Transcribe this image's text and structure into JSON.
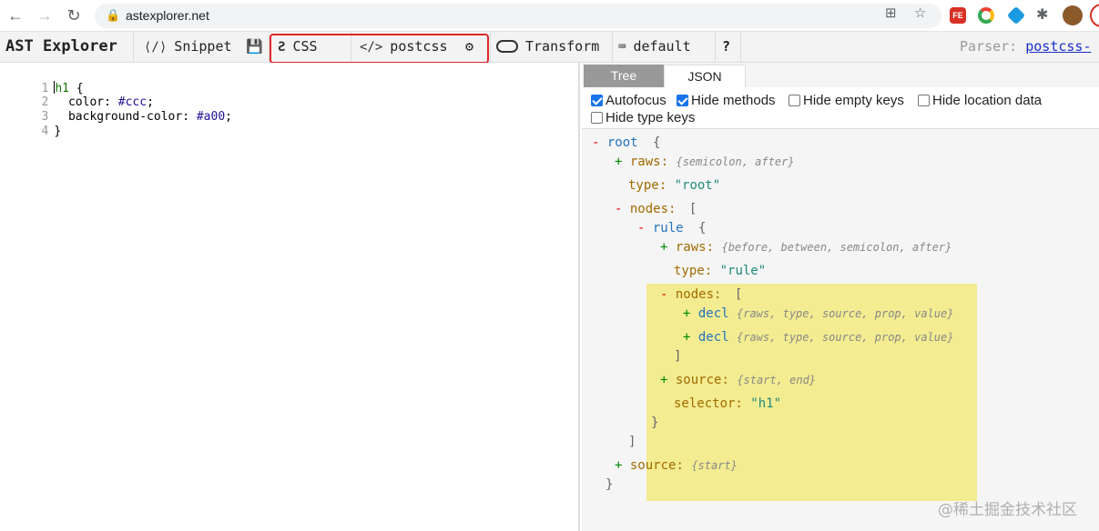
{
  "browser": {
    "url": "astexplorer.net",
    "back_icon": "arrow-left",
    "forward_icon": "arrow-right",
    "reload_icon": "reload",
    "ext_fe_label": "FE"
  },
  "toolbar": {
    "title": "AST Explorer",
    "snippet": "Snippet",
    "language": "CSS",
    "parser_name": "postcss",
    "transform": "Transform",
    "keymap": "default",
    "help": "?",
    "parser_label": "Parser:",
    "parser_link": "postcss-"
  },
  "editor": {
    "lines": [
      {
        "num": "1",
        "selector": "h1",
        "rest": " {"
      },
      {
        "num": "2",
        "prop": "  color: ",
        "value": "#ccc",
        "end": ";"
      },
      {
        "num": "3",
        "prop": "  background-color: ",
        "value": "#a00",
        "end": ";"
      },
      {
        "num": "4",
        "rest": "}"
      }
    ]
  },
  "output": {
    "tabs": [
      "Tree",
      "JSON"
    ],
    "active_tab": "Tree",
    "options": [
      {
        "label": "Autofocus",
        "checked": true
      },
      {
        "label": "Hide methods",
        "checked": true
      },
      {
        "label": "Hide empty keys",
        "checked": false
      },
      {
        "label": "Hide location data",
        "checked": false
      },
      {
        "label": "Hide type keys",
        "checked": false
      }
    ],
    "tree": {
      "root_toggle": "-",
      "root_name": "root",
      "root_open": "{",
      "raws_toggle": "+",
      "raws_key": "raws:",
      "raws_summary": "{semicolon, after}",
      "type_key": "type:",
      "type_value": "\"root\"",
      "nodes_toggle": "-",
      "nodes_key": "nodes:",
      "nodes_open": "[",
      "rule_toggle": "-",
      "rule_name": "rule",
      "rule_open": "{",
      "rule_raws_toggle": "+",
      "rule_raws_key": "raws:",
      "rule_raws_summary": "{before, between, semicolon, after}",
      "rule_type_key": "type:",
      "rule_type_value": "\"rule\"",
      "rule_nodes_toggle": "-",
      "rule_nodes_key": "nodes:",
      "rule_nodes_open": "[",
      "decl1_toggle": "+",
      "decl1_name": "decl",
      "decl1_summary": "{raws, type, source, prop, value}",
      "decl2_toggle": "+",
      "decl2_name": "decl",
      "decl2_summary": "{raws, type, source, prop, value}",
      "rule_nodes_close": "]",
      "rule_source_toggle": "+",
      "rule_source_key": "source:",
      "rule_source_summary": "{start, end}",
      "selector_key": "selector:",
      "selector_value": "\"h1\"",
      "rule_close": "}",
      "nodes_close": "]",
      "source_toggle": "+",
      "source_key": "source:",
      "source_summary": "{start}",
      "root_close": "}"
    }
  },
  "watermark": "@稀土掘金技术社区",
  "colors": {
    "highlight_box": "#e0272b",
    "tree_highlight": "#f3ec91",
    "parser_link": "#1a2fc9"
  }
}
